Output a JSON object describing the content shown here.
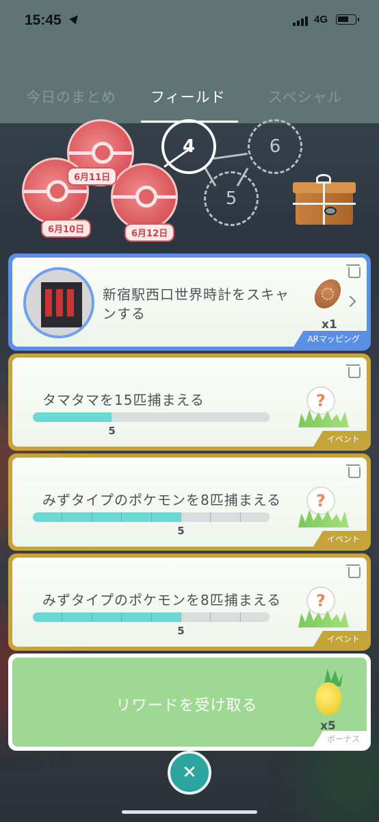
{
  "status_bar": {
    "time": "15:45",
    "network": "4G"
  },
  "tabs": [
    {
      "label": "今日のまとめ",
      "active": false
    },
    {
      "label": "フィールド",
      "active": true
    },
    {
      "label": "スペシャル",
      "active": false
    }
  ],
  "streak": {
    "completed_stamps": [
      "6月10日",
      "6月11日",
      "6月12日"
    ],
    "current_day": "4",
    "next_days": [
      "5",
      "6"
    ],
    "reward_icon": "mystery-box-icon"
  },
  "tasks": [
    {
      "type": "ar",
      "text": "新宿駅西口世界時計をスキャンする",
      "reward_icon": "pinap-berry-icon",
      "reward_qty": "x1",
      "tag": "ARマッピング"
    },
    {
      "type": "event",
      "text": "タマタマを15匹捕まえる",
      "progress_value": "5",
      "progress_fraction": 0.3333,
      "segments": 1,
      "reward_icon": "mystery-pokemon-icon",
      "tag": "イベント"
    },
    {
      "type": "event",
      "text": "みずタイプのポケモンを8匹捕まえる",
      "progress_value": "5",
      "progress_fraction": 0.625,
      "segments": 8,
      "reward_icon": "mystery-pokemon-icon",
      "tag": "イベント"
    },
    {
      "type": "event",
      "text": "みずタイプのポケモンを8匹捕まえる",
      "progress_value": "5",
      "progress_fraction": 0.625,
      "segments": 8,
      "reward_icon": "mystery-pokemon-icon",
      "tag": "イベント"
    }
  ],
  "reward_card": {
    "label": "リワードを受け取る",
    "reward_icon": "golden-pinap-berry-icon",
    "qty": "x5",
    "tag": "ボーナス"
  },
  "colors": {
    "ar_border": "#5b8fe6",
    "event_border": "#c5a43a",
    "progress_fill": "#6ad9d3",
    "reward_bg": "#9fd892",
    "close_button": "#2ea49e"
  }
}
